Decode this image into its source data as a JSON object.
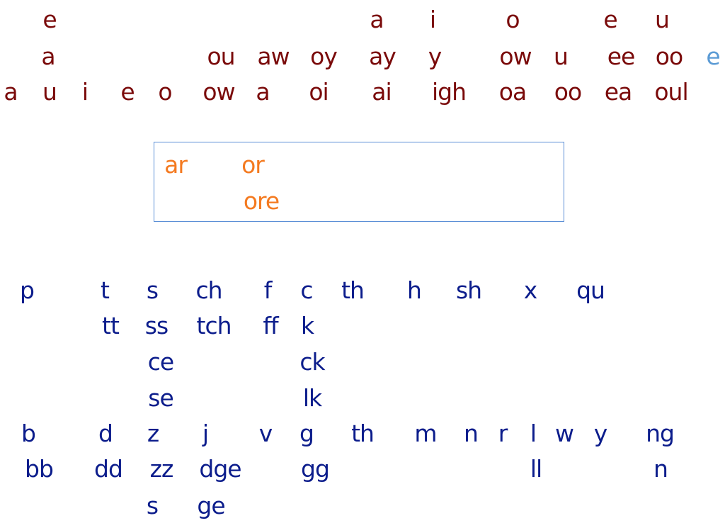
{
  "colors": {
    "vowels": "#7a0a0a",
    "schwa": "#5b9bd5",
    "r_controlled": "#f47a20",
    "consonants": "#0c1d8c",
    "box_border": "#5b8fd6"
  },
  "vowels": {
    "row1": [
      "e",
      "a",
      "i",
      "o",
      "e",
      "u"
    ],
    "row2": [
      "a",
      "ou",
      "aw",
      "oy",
      "ay",
      "y",
      "ow",
      "u",
      "ee",
      "oo"
    ],
    "row2_extra": "e",
    "row3": [
      "a",
      "u",
      "i",
      "e",
      "o",
      "ow",
      "a",
      "oi",
      "ai",
      "igh",
      "oa",
      "oo",
      "ea",
      "oul"
    ]
  },
  "r_controlled": {
    "row1": [
      "ar",
      "or"
    ],
    "row2": [
      "ore"
    ]
  },
  "consonants": {
    "row1": [
      "p",
      "t",
      "s",
      "ch",
      "f",
      "c",
      "th",
      "h",
      "sh",
      "x",
      "qu"
    ],
    "row2": [
      "tt",
      "ss",
      "tch",
      "ff",
      "k"
    ],
    "row3": [
      "ce",
      "ck"
    ],
    "row4": [
      "se",
      "lk"
    ],
    "row5": [
      "b",
      "d",
      "z",
      "j",
      "v",
      "g",
      "th",
      "m",
      "n",
      "r",
      "l",
      "w",
      "y",
      "ng"
    ],
    "row6": [
      "bb",
      "dd",
      "zz",
      "dge",
      "gg",
      "ll",
      "n"
    ],
    "row7": [
      "s",
      "ge"
    ]
  }
}
